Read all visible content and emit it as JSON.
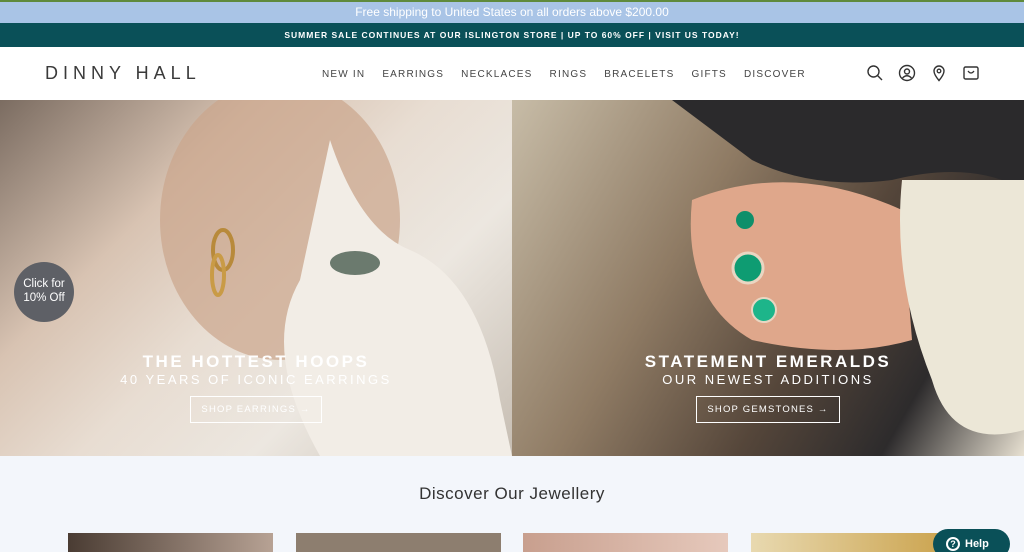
{
  "shipping_bar": {
    "text": "Free shipping to United States on all orders above $200.00"
  },
  "sale_bar": {
    "text": "SUMMER SALE CONTINUES AT OUR ISLINGTON STORE | UP TO 60% OFF | VISIT US TODAY!"
  },
  "header": {
    "logo": "DINNY HALL",
    "nav": [
      "NEW IN",
      "EARRINGS",
      "NECKLACES",
      "RINGS",
      "BRACELETS",
      "GIFTS",
      "DISCOVER"
    ],
    "icons": [
      "search-icon",
      "account-icon",
      "location-icon",
      "cart-icon"
    ]
  },
  "hero_left": {
    "title": "THE HOTTEST HOOPS",
    "subtitle": "40 YEARS OF ICONIC EARRINGS",
    "button": "SHOP EARRINGS →"
  },
  "hero_right": {
    "title": "STATEMENT EMERALDS",
    "subtitle": "OUR NEWEST ADDITIONS",
    "button": "SHOP GEMSTONES →"
  },
  "discount_badge": {
    "line1": "Click for",
    "line2": "10% Off"
  },
  "discover": {
    "title": "Discover Our Jewellery"
  },
  "help_button": {
    "label": "Help"
  },
  "colors": {
    "brand_teal": "#0a5058",
    "shipping_blue": "#a9c4e6",
    "page_bg": "#f3f6fb"
  }
}
